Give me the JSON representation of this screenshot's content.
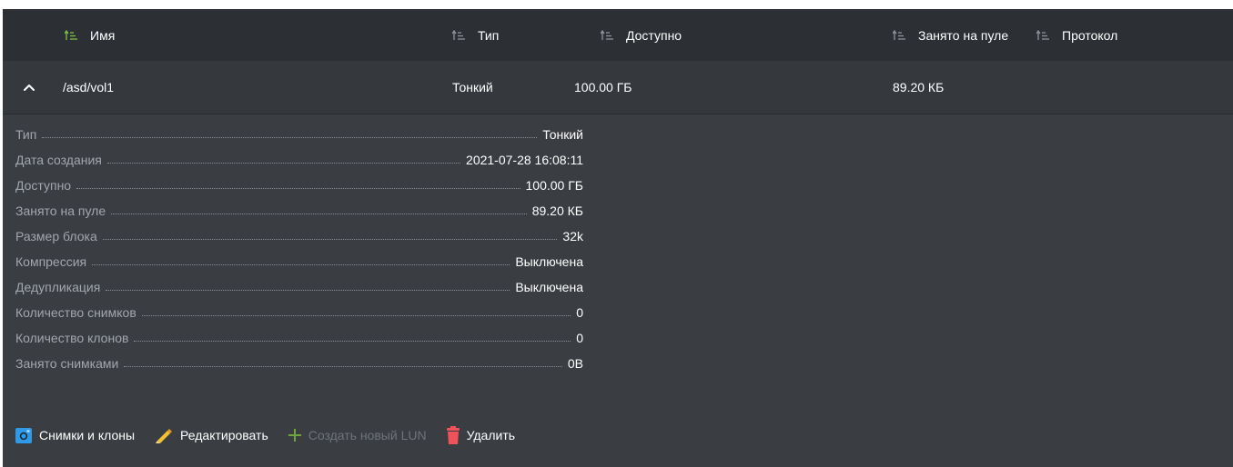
{
  "colors": {
    "header_bg": "#2c2f34",
    "panel_bg": "#3a3d42",
    "row_bg": "#35383d",
    "accent_green": "#7cc242",
    "camera_blue": "#2f9be8",
    "pencil_yellow": "#f2c12e",
    "trash_red": "#f0525c"
  },
  "table": {
    "columns": [
      {
        "label": "Имя",
        "icon": "sort-icon",
        "sorted": true
      },
      {
        "label": "Тип",
        "icon": "sort-icon",
        "sorted": false
      },
      {
        "label": "Доступно",
        "icon": "sort-icon",
        "sorted": false
      },
      {
        "label": "Занято на пуле",
        "icon": "sort-icon",
        "sorted": false
      },
      {
        "label": "Протокол",
        "icon": "sort-icon",
        "sorted": false
      }
    ],
    "row": {
      "expand_icon": "chevron-up-icon",
      "name": "/asd/vol1",
      "type": "Тонкий",
      "available": "100.00 ГБ",
      "used_on_pool": "89.20 КБ",
      "protocol": ""
    }
  },
  "details": [
    {
      "label": "Тип",
      "value": "Тонкий"
    },
    {
      "label": "Дата создания",
      "value": "2021-07-28 16:08:11"
    },
    {
      "label": "Доступно",
      "value": "100.00 ГБ"
    },
    {
      "label": "Занято на пуле",
      "value": "89.20 КБ"
    },
    {
      "label": "Размер блока",
      "value": "32k"
    },
    {
      "label": "Компрессия",
      "value": "Выключена"
    },
    {
      "label": "Дедупликация",
      "value": "Выключена"
    },
    {
      "label": "Количество снимков",
      "value": "0"
    },
    {
      "label": "Количество клонов",
      "value": "0"
    },
    {
      "label": "Занято снимками",
      "value": "0B"
    }
  ],
  "actions": {
    "snapshots": {
      "label": "Снимки и клоны",
      "icon": "camera-icon",
      "enabled": true
    },
    "edit": {
      "label": "Редактировать",
      "icon": "pencil-icon",
      "enabled": true
    },
    "create_lun": {
      "label": "Создать новый LUN",
      "icon": "plus-icon",
      "enabled": false
    },
    "delete": {
      "label": "Удалить",
      "icon": "trash-icon",
      "enabled": true
    }
  }
}
